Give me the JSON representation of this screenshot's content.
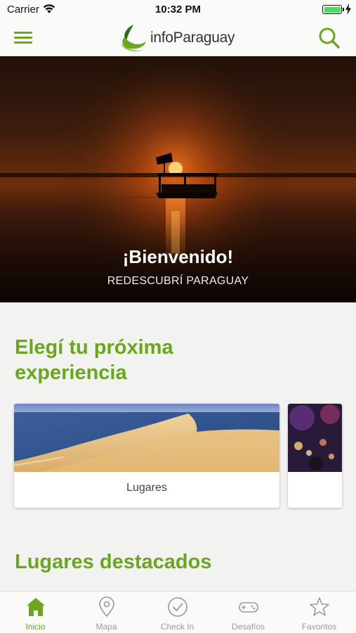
{
  "status_bar": {
    "carrier": "Carrier",
    "time": "10:32 PM",
    "battery_level": 1.0
  },
  "header": {
    "app_name": "infoParaguay",
    "menu_icon": "hamburger-menu-icon",
    "search_icon": "search-icon",
    "brand_color": "#6aa61e"
  },
  "hero": {
    "title": "¡Bienvenido!",
    "subtitle": "REDESCUBRÍ PARAGUAY"
  },
  "experience_section": {
    "title": "Elegí tu próxima experiencia",
    "cards": [
      {
        "label": "Lugares",
        "image": "sand-dunes-by-river-photo"
      },
      {
        "label": "",
        "image": "night-lights-photo"
      }
    ]
  },
  "featured_section": {
    "title": "Lugares destacados"
  },
  "tab_bar": {
    "active": "Inicio",
    "tabs": [
      {
        "label": "Inicio",
        "icon": "home-icon"
      },
      {
        "label": "Mapa",
        "icon": "map-pin-icon"
      },
      {
        "label": "Check In",
        "icon": "check-circle-icon"
      },
      {
        "label": "Desafíos",
        "icon": "gamepad-icon"
      },
      {
        "label": "Favoritos",
        "icon": "star-icon"
      }
    ]
  }
}
